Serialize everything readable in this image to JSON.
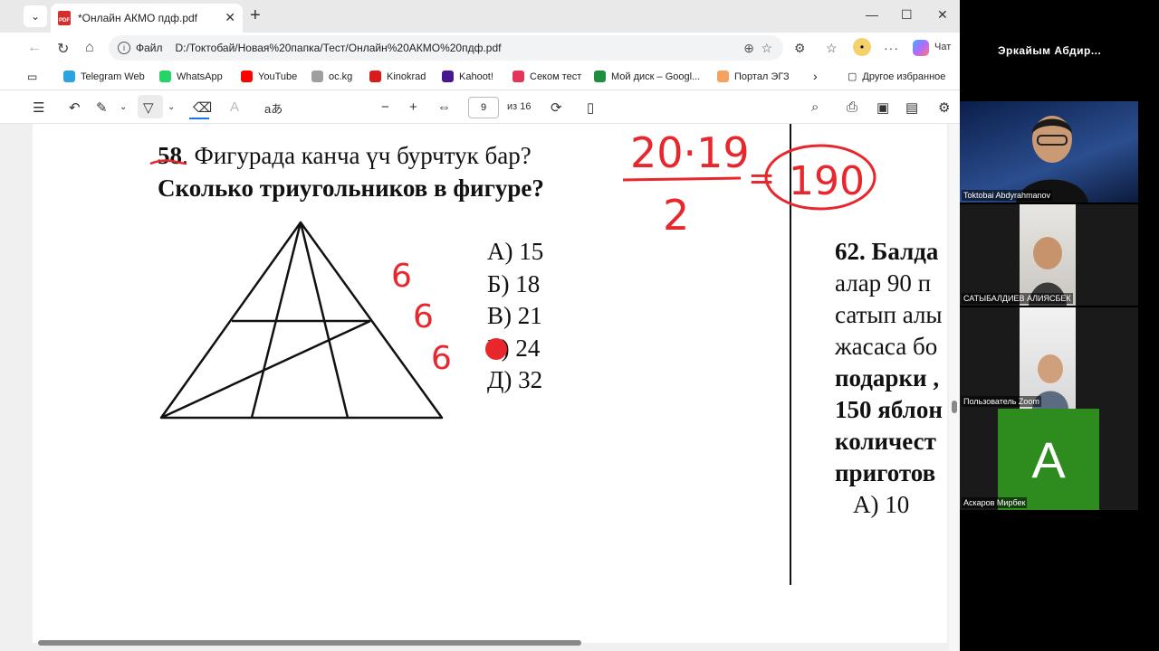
{
  "browser": {
    "tab_title": "*Онлайн АКМО пдф.pdf",
    "pdf_icon_text": "PDF",
    "address": {
      "scheme_label": "Файл",
      "url": "D:/Токтобай/Новая%20папка/Тест/Онлайн%20АКМО%20пдф.pdf"
    },
    "chat_label": "Чат",
    "bookmarks": [
      {
        "label": "Telegram Web",
        "color": "#2aa3e0"
      },
      {
        "label": "WhatsApp",
        "color": "#25d366"
      },
      {
        "label": "YouTube",
        "color": "#ff0000"
      },
      {
        "label": "oc.kg",
        "color": "#9e9e9e"
      },
      {
        "label": "Kinokrad",
        "color": "#d81b1b"
      },
      {
        "label": "Kahoot!",
        "color": "#46178f"
      },
      {
        "label": "Секом тест",
        "color": "#e5335a"
      },
      {
        "label": "Мой диск – Googl...",
        "color": "#1e8e3e"
      },
      {
        "label": "Портал ЭГЗ",
        "color": "#f4a261"
      }
    ],
    "other_favorites": "Другое избранное"
  },
  "pdf_toolbar": {
    "read_aloud_label": "aあ",
    "page_current": "9",
    "page_total": "из 16"
  },
  "document": {
    "q58_number": "58",
    "q58_line1": ". Фигурада канча үч бурчтук бар?",
    "q58_line2": "Сколько триугольников в фигуре?",
    "answers": [
      "А) 15",
      "Б) 18",
      "В) 21",
      "Г) 24",
      "Д) 32"
    ],
    "q62_lines": [
      "62. Балда",
      "алар 90 п",
      "сатып алы",
      "жасаса бо",
      "подарки ,",
      "150 яблон",
      "количест",
      "приготов",
      "А) 10"
    ],
    "annotations": {
      "numerator": "20·19",
      "denominator": "2",
      "equals": "=",
      "result": "190",
      "margin_counts": [
        "6",
        "6",
        "6"
      ]
    }
  },
  "zoom": {
    "host_name": "Эркайым Абдир...",
    "participants": [
      {
        "name": "Toktobai Abdyrahmanov"
      },
      {
        "name": "САТЫБАЛДИЕВ АЛИЯСБЕК"
      },
      {
        "name": "Пользователь Zoom"
      },
      {
        "name": "Аскаров Мирбек",
        "initial": "A",
        "color": "#2e8b1e"
      }
    ]
  }
}
